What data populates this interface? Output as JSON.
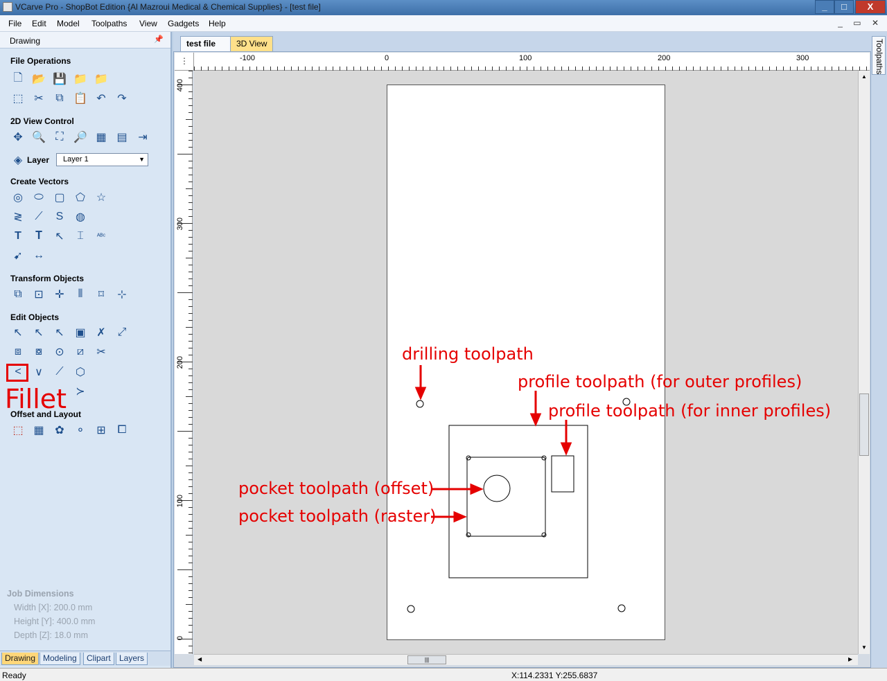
{
  "window": {
    "title": "VCarve Pro - ShopBot Edition {Al Mazroui Medical & Chemical Supplies} - [test file]",
    "minimize": "_",
    "maximize": "□",
    "close": "X"
  },
  "menu": {
    "items": [
      "File",
      "Edit",
      "Model",
      "Toolpaths",
      "View",
      "Gadgets",
      "Help"
    ],
    "mdi_controls": "_ ▭ ✕"
  },
  "panel": {
    "title": "Drawing",
    "pin": "📌",
    "sections": {
      "file_operations": "File Operations",
      "view_control": "2D View Control",
      "create_vectors": "Create Vectors",
      "transform_objects": "Transform Objects",
      "edit_objects": "Edit Objects",
      "offset_layout": "Offset and Layout"
    },
    "layer": {
      "label": "Layer",
      "value": "Layer 1"
    },
    "fillet_label": "Fillet",
    "job_dimensions": {
      "title": "Job Dimensions",
      "width": "Width  [X]: 200.0 mm",
      "height": "Height [Y]: 400.0 mm",
      "depth": "Depth  [Z]: 18.0 mm"
    },
    "bottom_tabs": [
      "Drawing",
      "Modeling",
      "Clipart",
      "Layers"
    ]
  },
  "doc_tabs": [
    "test file",
    "3D View"
  ],
  "ruler": {
    "h_labels": [
      "-100",
      "0",
      "100",
      "200",
      "300"
    ],
    "v_labels": [
      "400",
      "300",
      "200",
      "100",
      "0"
    ]
  },
  "annotations": {
    "drilling": "drilling toolpath",
    "profile_outer": "profile toolpath (for outer profiles)",
    "profile_inner": "profile toolpath (for inner profiles)",
    "pocket_offset": "pocket toolpath (offset)",
    "pocket_raster": "pocket toolpath (raster)"
  },
  "right_panel_tab": "Toolpaths",
  "status": {
    "left": "Ready",
    "coords": "X:114.2331 Y:255.6837"
  },
  "colors": {
    "annotation_red": "#e50000",
    "panel_bg": "#d9e6f4",
    "active_tab": "#ffd77a"
  }
}
